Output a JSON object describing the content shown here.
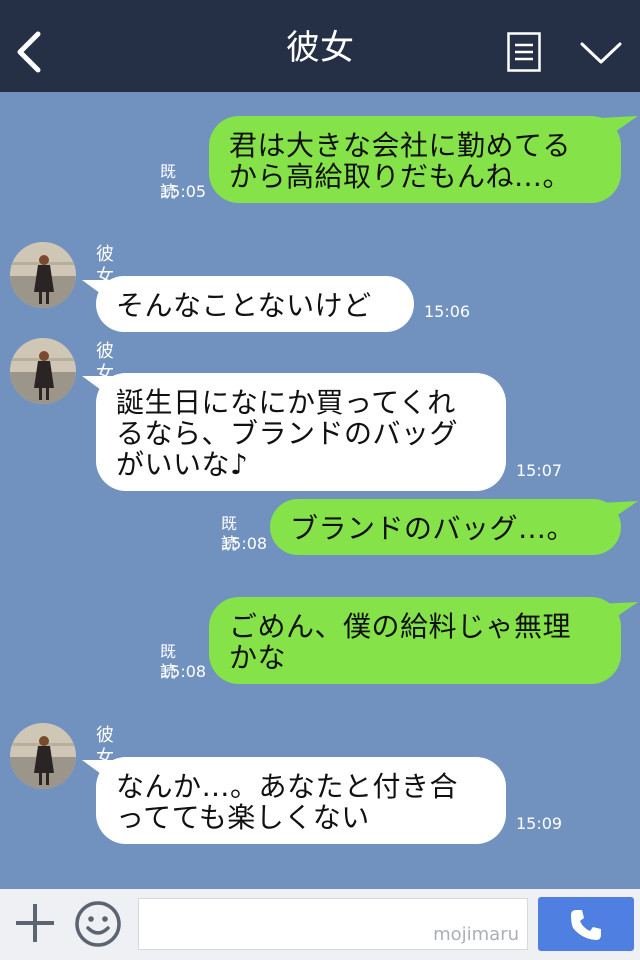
{
  "header": {
    "title": "彼女"
  },
  "messages": [
    {
      "lines": [
        "君は大きな会社に勤めてる",
        "から高給取りだもんね…。"
      ],
      "read": "既読",
      "time": "15:05"
    },
    {
      "sender": "彼女",
      "lines": [
        "そんなことないけど"
      ],
      "time": "15:06"
    },
    {
      "sender": "彼女",
      "lines": [
        "誕生日になにか買ってくれ",
        "るなら、ブランドのバッグ",
        "がいいな♪"
      ],
      "time": "15:07"
    },
    {
      "lines": [
        "ブランドのバッグ…。"
      ],
      "read": "既読",
      "time": "15:08"
    },
    {
      "lines": [
        "ごめん、僕の給料じゃ無理",
        "かな"
      ],
      "read": "既読",
      "time": "15:08"
    },
    {
      "sender": "彼女",
      "lines": [
        "なんか…。あなたと付き合",
        "ってても楽しくない"
      ],
      "time": "15:09"
    }
  ],
  "footer": {
    "watermark": "mojimaru"
  },
  "colors": {
    "header": "#253046",
    "background": "#7192bf",
    "outgoing": "#85e249",
    "incoming": "#ffffff",
    "send": "#4e7fe1"
  },
  "icons": [
    "back-chevron-icon",
    "menu-icon",
    "chevron-down-icon",
    "plus-icon",
    "smile-icon",
    "phone-icon"
  ]
}
